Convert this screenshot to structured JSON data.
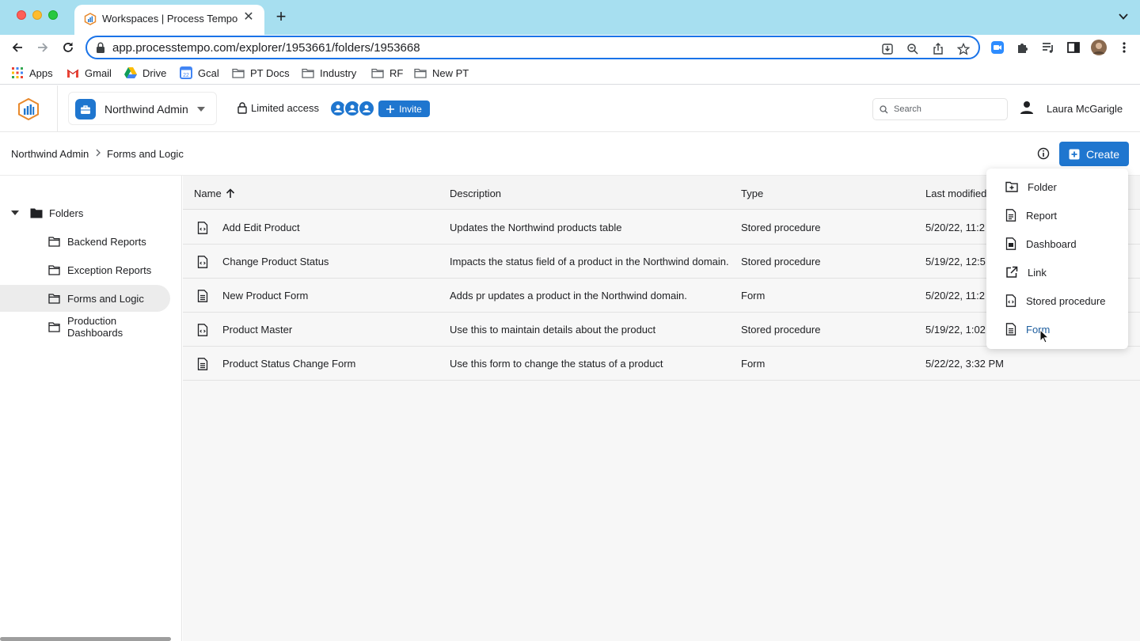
{
  "browser": {
    "tab_title": "Workspaces | Process Tempo",
    "tab_close": "✕",
    "new_tab": "+",
    "url": "app.processtempo.com/explorer/1953661/folders/1953668",
    "bookmarks": [
      "Apps",
      "Gmail",
      "Drive",
      "Gcal",
      "PT Docs",
      "Industry",
      "RF",
      "New PT"
    ]
  },
  "header": {
    "workspace": "Northwind Admin",
    "access": "Limited access",
    "invite_label": "Invite",
    "search_placeholder": "Search",
    "user_name": "Laura McGarigle"
  },
  "breadcrumb": {
    "root": "Northwind Admin",
    "separator": ">",
    "current": "Forms and Logic"
  },
  "create_label": "Create",
  "sidebar": {
    "root_label": "Folders",
    "items": [
      {
        "label": "Backend Reports",
        "selected": false
      },
      {
        "label": "Exception Reports",
        "selected": false
      },
      {
        "label": "Forms and Logic",
        "selected": true
      },
      {
        "label": "Production Dashboards",
        "selected": false
      }
    ]
  },
  "table": {
    "columns": [
      "Name",
      "Description",
      "Type",
      "Last modified"
    ],
    "sort": {
      "column": "Name",
      "direction": "ascending"
    },
    "rows": [
      {
        "name": "Add Edit Product",
        "description": "Updates the Northwind products table",
        "type": "Stored procedure",
        "modified": "5/20/22, 11:2"
      },
      {
        "name": "Change Product Status",
        "description": "Impacts the status field of a product in the Northwind domain.",
        "type": "Stored procedure",
        "modified": "5/19/22, 12:5"
      },
      {
        "name": "New Product Form",
        "description": "Adds pr updates a product in the Northwind domain.",
        "type": "Form",
        "modified": "5/20/22, 11:2"
      },
      {
        "name": "Product Master",
        "description": "Use this to maintain details about the product",
        "type": "Stored procedure",
        "modified": "5/19/22, 1:02"
      },
      {
        "name": "Product Status Change Form",
        "description": "Use this form to change the status of a product",
        "type": "Form",
        "modified": "5/22/22, 3:32 PM"
      }
    ]
  },
  "create_menu": {
    "items": [
      "Folder",
      "Report",
      "Dashboard",
      "Link",
      "Stored procedure",
      "Form"
    ],
    "hovered": "Form"
  },
  "colors": {
    "accent": "#1f76cf",
    "tab_bar": "#a7dff0",
    "selected_row": "#ececec"
  }
}
